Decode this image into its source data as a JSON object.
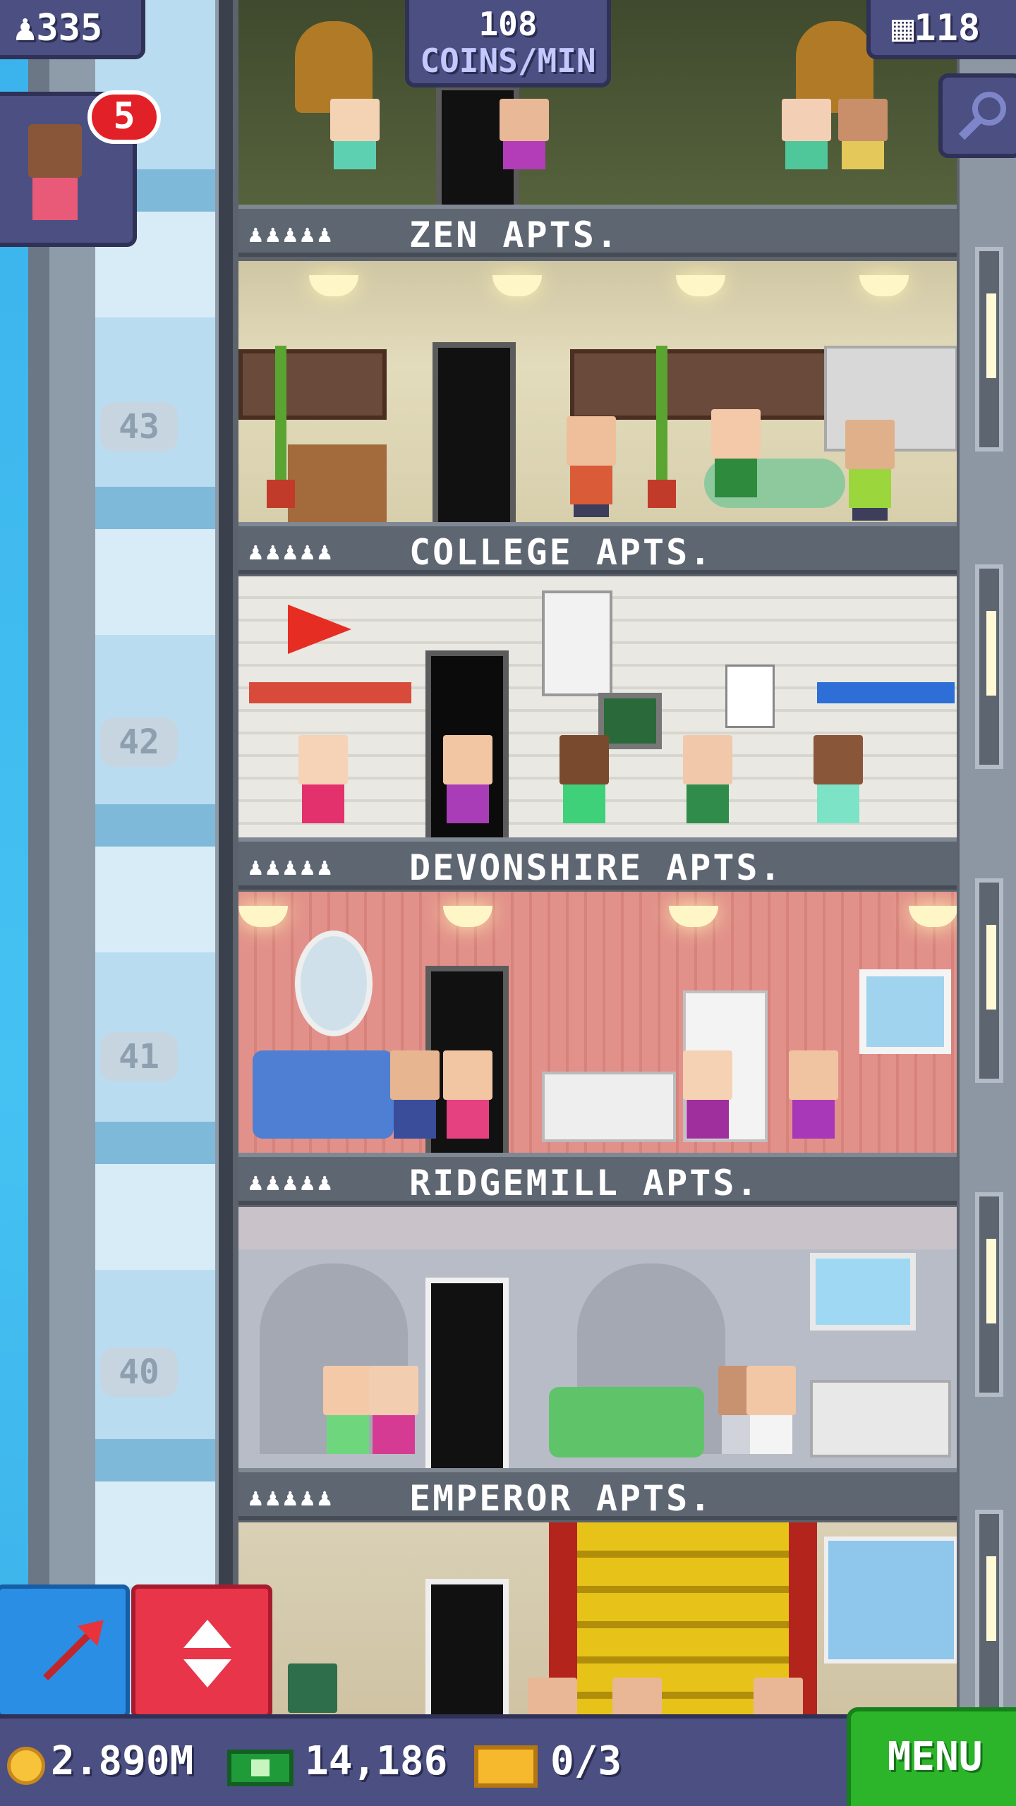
{
  "hud": {
    "population": "335",
    "coins_per_min_value": "108",
    "coins_per_min_unit": "COINS/MIN",
    "floor_count": "118",
    "visitor_badge": "5"
  },
  "floors": [
    {
      "name": "ZEN APTS.",
      "residents": "♟♟♟♟♟",
      "number": ""
    },
    {
      "name": "COLLEGE APTS.",
      "residents": "♟♟♟♟♟",
      "number": "43"
    },
    {
      "name": "DEVONSHIRE APTS.",
      "residents": "♟♟♟♟♟",
      "number": "42"
    },
    {
      "name": "RIDGEMILL APTS.",
      "residents": "♟♟♟♟♟",
      "number": "41"
    },
    {
      "name": "EMPEROR APTS.",
      "residents": "♟♟♟♟♟",
      "number": "40"
    }
  ],
  "bottom_bar": {
    "coins": "2.890M",
    "bux": "14,186",
    "tickets": "0/3",
    "menu_label": "MENU"
  },
  "icons": {
    "population": "person-icon",
    "floors": "building-icon",
    "search": "magnifier-icon",
    "coins": "coin-icon",
    "bux": "bux-icon",
    "tickets": "ticket-icon",
    "move": "arrow-icon",
    "elevator": "up-down-icon"
  },
  "colors": {
    "hud_panel": "#4b4f82",
    "menu_green": "#2cb52a",
    "elevator_red": "#e8354a",
    "move_blue": "#2a8ee4",
    "sky": "#3fb4ea"
  }
}
